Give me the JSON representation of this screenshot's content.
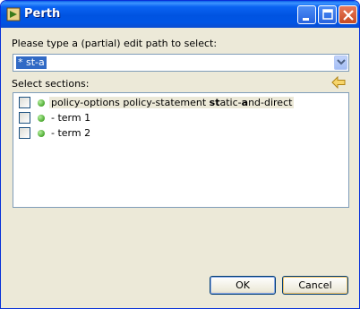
{
  "window": {
    "title": "Perth"
  },
  "path_field": {
    "label": "Please type a (partial) edit path to select:",
    "value": "* st-a"
  },
  "sections": {
    "label": "Select sections:",
    "items": [
      {
        "prefix": "policy-options policy-statement ",
        "match": "st",
        "middle": "atic-",
        "match2": "a",
        "suffix": "nd-direct",
        "checked": false
      },
      {
        "text": "- term 1",
        "checked": false
      },
      {
        "text": "- term 2",
        "checked": false
      }
    ]
  },
  "buttons": {
    "ok": "OK",
    "cancel": "Cancel"
  },
  "colors": {
    "title_bar": "#0055e5",
    "selection": "#316ac5",
    "status_dot": "#4aa82e"
  }
}
